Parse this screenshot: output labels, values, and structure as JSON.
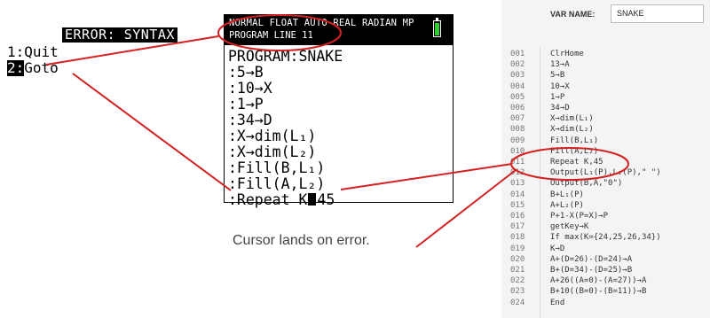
{
  "error_menu": {
    "title": "ERROR: SYNTAX",
    "items": [
      {
        "num": "1:",
        "label": "Quit",
        "selected": false
      },
      {
        "num": "2:",
        "label": "Goto",
        "selected": true
      }
    ]
  },
  "calculator": {
    "status_line1": "NORMAL FLOAT AUTO REAL RADIAN MP",
    "status_line2": "PROGRAM LINE 11",
    "battery_color": "#2fcf2f",
    "program_title": "PROGRAM:SNAKE",
    "lines": [
      ":5→B",
      ":10→X",
      ":1→P",
      ":34→D",
      ":X→dim(L₁)",
      ":X→dim(L₂)",
      ":Fill(B,L₁)",
      ":Fill(A,L₂)"
    ],
    "cursor_line_before": ":Repeat K",
    "cursor_line_after": "45"
  },
  "annotation": "Cursor lands on error.",
  "editor": {
    "var_name_label": "VAR NAME:",
    "var_name_value": "SNAKE",
    "line_numbers": [
      "001",
      "002",
      "003",
      "004",
      "005",
      "006",
      "007",
      "008",
      "009",
      "010",
      "011",
      "012",
      "013",
      "014",
      "015",
      "016",
      "017",
      "018",
      "019",
      "020",
      "021",
      "022",
      "023",
      "024"
    ],
    "code_lines": [
      "ClrHome",
      "13→A",
      "5→B",
      "10→X",
      "1→P",
      "34→D",
      "X→dim(L₁)",
      "X→dim(L₂)",
      "Fill(B,L₁)",
      "Fill(A,L₂)",
      "Repeat K,45",
      "Output(L₁(P),L₂(P),\" \")",
      "Output(B,A,\"0\")",
      "B+L₁(P)",
      "A+L₂(P)",
      "P+1-X(P=X)→P",
      "getKey→K",
      "If max(K={24,25,26,34})",
      "K→D",
      "A+(D=26)-(D=24)→A",
      "B+(D=34)-(D=25)→B",
      "A+26((A=0)-(A=27))→A",
      "B+10((B=0)-(B=11))→B",
      "End"
    ]
  },
  "highlight_color": "#d42020"
}
